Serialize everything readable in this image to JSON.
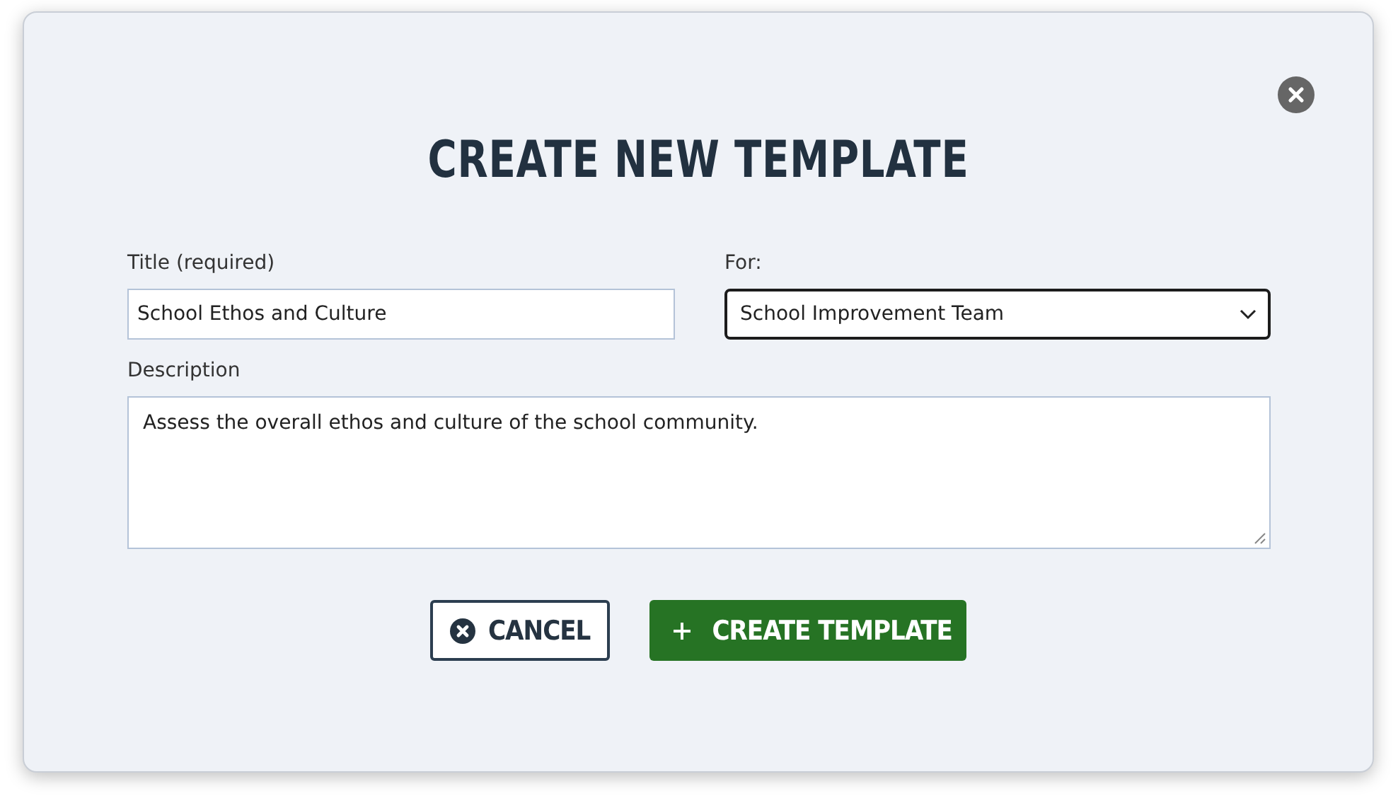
{
  "dialog": {
    "title": "CREATE NEW TEMPLATE",
    "fields": [
      {
        "kind": "text",
        "label": "Title (required)",
        "value": "School Ethos and Culture",
        "focused": false
      },
      {
        "kind": "select",
        "label": "For:",
        "value": "School Improvement Team",
        "focused": true
      },
      {
        "kind": "textarea",
        "label": "Description",
        "value": "Assess the overall ethos and culture of the school community.",
        "focused": false
      }
    ],
    "buttons": [
      {
        "kind": "cancel",
        "label": "CANCEL"
      },
      {
        "kind": "create",
        "label": "CREATE TEMPLATE"
      }
    ]
  }
}
